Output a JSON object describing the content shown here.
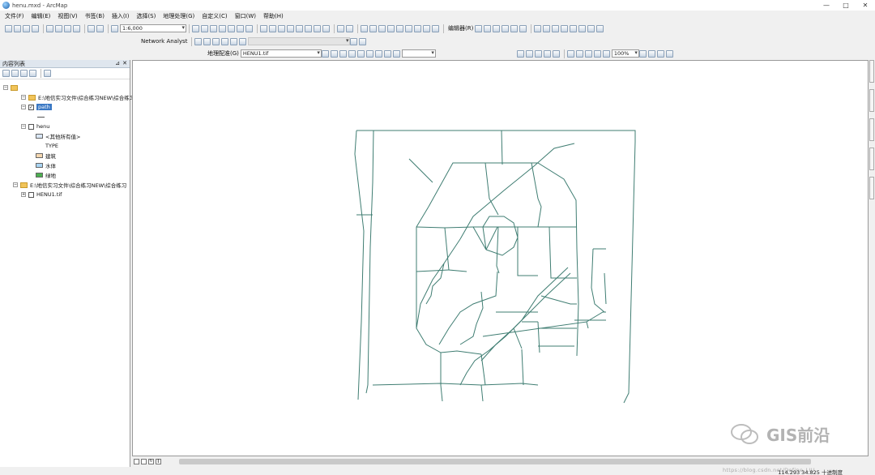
{
  "window": {
    "title": "henu.mxd - ArcMap"
  },
  "menu": [
    "文件(F)",
    "编辑(E)",
    "视图(V)",
    "书签(B)",
    "插入(I)",
    "选择(S)",
    "地理处理(G)",
    "自定义(C)",
    "窗口(W)",
    "帮助(H)"
  ],
  "toolbar": {
    "scale_value": "1:6,000",
    "network_analyst_label": "Network Analyst",
    "editor_label": "编辑器(R)",
    "georef_label": "地理配准(G)",
    "georef_layer": "HENU1.tif",
    "zoom_percent": "100%"
  },
  "toc": {
    "title": "内容列表",
    "items": [
      {
        "label": "E:\\地信实习文件\\综合练习NEW\\综合练习"
      },
      {
        "label": "path"
      },
      {
        "label": "henu"
      },
      {
        "label": "<其他所有值>"
      },
      {
        "label": "TYPE"
      },
      {
        "label": "建筑"
      },
      {
        "label": "水体"
      },
      {
        "label": "绿地"
      },
      {
        "label": "E:\\地信实习文件\\综合练习NEW\\综合练习"
      },
      {
        "label": "HENU1.tif"
      }
    ],
    "swatch_colors": {
      "building": "#f4d7b0",
      "water": "#a9d4f2",
      "green": "#4caf50"
    }
  },
  "map": {
    "line_color": "#3f7d72"
  },
  "status": {
    "coords": "114.293  34.825  十进制度",
    "watermark_url": "https://blog.csdn.net/Define_LIU"
  },
  "watermark": {
    "text": "GIS前沿"
  }
}
